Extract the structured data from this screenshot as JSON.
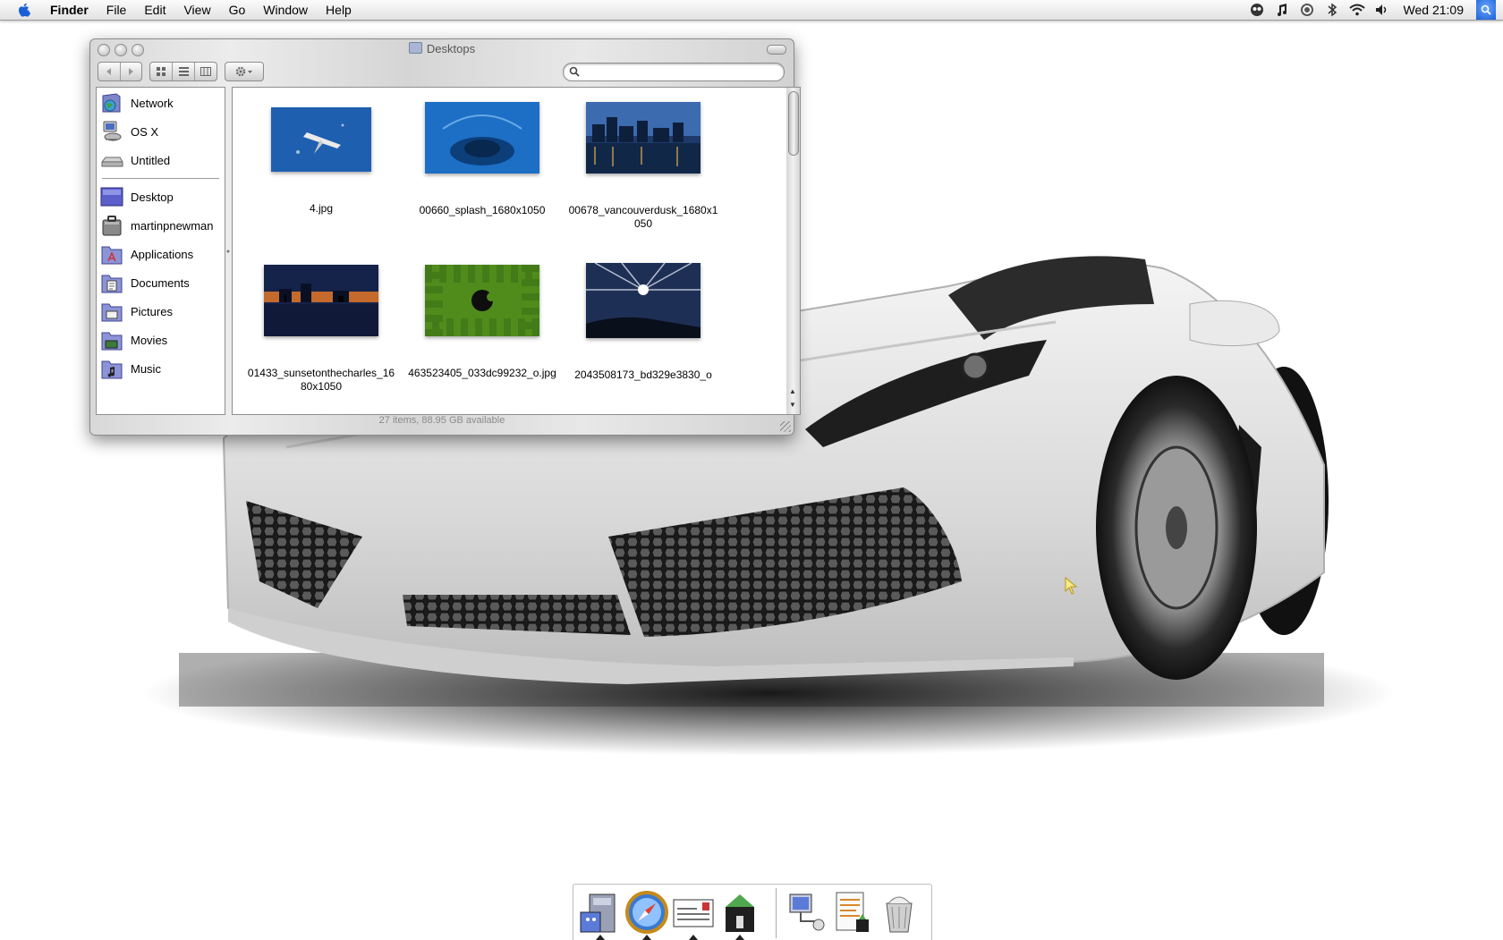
{
  "menubar": {
    "app_name": "Finder",
    "menus": [
      "File",
      "Edit",
      "View",
      "Go",
      "Window",
      "Help"
    ],
    "status_icons": [
      "growl-icon",
      "itunes-icon",
      "sync-icon",
      "bluetooth-icon",
      "wifi-icon",
      "volume-icon"
    ],
    "clock": "Wed 21:09"
  },
  "window": {
    "title": "Desktops",
    "search": {
      "value": "",
      "placeholder": ""
    },
    "view_modes": [
      "icon-view",
      "list-view",
      "column-view"
    ],
    "status": "27 items, 88.95 GB available"
  },
  "sidebar": {
    "devices": [
      {
        "label": "Network",
        "icon": "network-globe-icon"
      },
      {
        "label": "OS X",
        "icon": "computer-disk-icon"
      },
      {
        "label": "Untitled",
        "icon": "hard-drive-icon"
      }
    ],
    "places": [
      {
        "label": "Desktop",
        "icon": "desktop-icon"
      },
      {
        "label": "martinpnewman",
        "icon": "home-icon"
      },
      {
        "label": "Applications",
        "icon": "applications-folder-icon"
      },
      {
        "label": "Documents",
        "icon": "documents-folder-icon"
      },
      {
        "label": "Pictures",
        "icon": "pictures-folder-icon"
      },
      {
        "label": "Movies",
        "icon": "movies-folder-icon"
      },
      {
        "label": "Music",
        "icon": "music-folder-icon"
      }
    ]
  },
  "files": [
    {
      "name": "4.jpg",
      "thumb": "space-shuttle-thumbnail",
      "color": "#1f5fb0"
    },
    {
      "name": "00660_splash_1680x1050",
      "thumb": "water-splash-thumbnail",
      "color": "#1c6fc4"
    },
    {
      "name": "00678_vancouverdusk_1680x1050",
      "thumb": "city-dusk-thumbnail",
      "color": "#1d3a6a"
    },
    {
      "name": "01433_sunsetonthecharles_1680x1050",
      "thumb": "sunset-river-thumbnail",
      "color": "#15224a"
    },
    {
      "name": "463523405_033dc99232_o.jpg",
      "thumb": "green-apple-thumbnail",
      "color": "#4f8c1c"
    },
    {
      "name": "2043508173_bd329e3830_o",
      "thumb": "lighthouse-thumbnail",
      "color": "#1e2f55"
    }
  ],
  "dock": {
    "apps": [
      "finder-icon",
      "safari-icon",
      "mail-icon",
      "utility-icon",
      "network-utility-icon",
      "activity-log-icon",
      "trash-icon"
    ]
  },
  "colors": {
    "menu_accent": "#1a5fd6",
    "car_body": "#e6e6e6"
  }
}
